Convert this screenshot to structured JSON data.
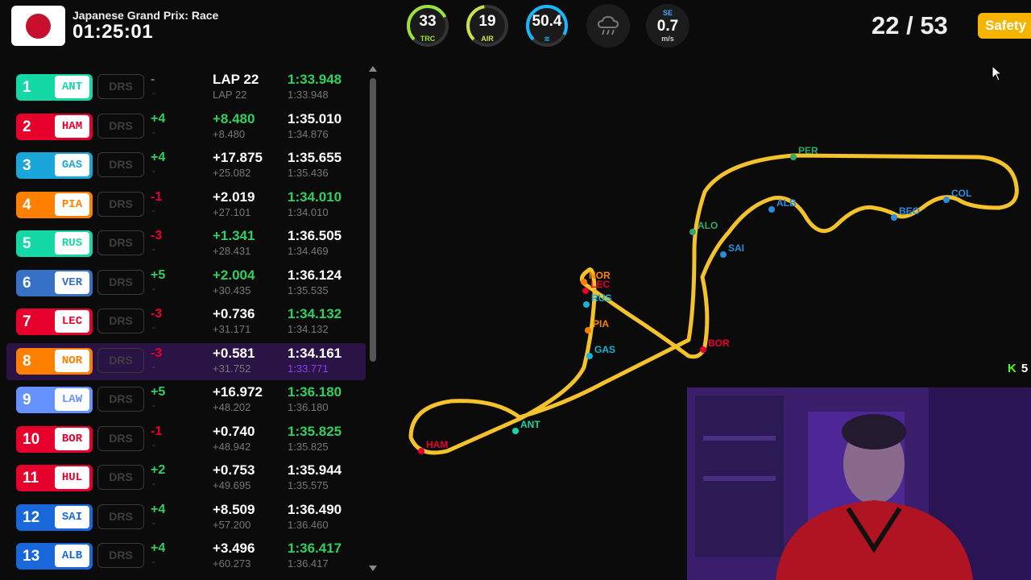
{
  "header": {
    "race_title": "Japanese Grand Prix: Race",
    "race_time": "01:25:01",
    "lap_label": "22 / 53",
    "safety_label": "Safety",
    "gauges": [
      {
        "value": "33",
        "label": "TRC",
        "color": "#9be13a",
        "fraction": 0.55
      },
      {
        "value": "19",
        "label": "AIR",
        "color": "#c7e34b",
        "fraction": 0.35
      },
      {
        "value": "50.4",
        "label": "",
        "color": "#19b7ff",
        "fraction": 0.7
      }
    ],
    "wind_direction": "SE",
    "wind_speed": "0.7",
    "wind_unit": "m/s",
    "weather_icon": "rain-cloud-icon"
  },
  "standings": [
    {
      "pos": "1",
      "code": "ANT",
      "color": "#14d9a6",
      "drs": "DRS",
      "change": "-",
      "change_color": "#777",
      "gap": "LAP 22",
      "sub_gap": "LAP 22",
      "lap": "1:33.948",
      "lap_color": "#2fd060",
      "sub_lap": "1:33.948"
    },
    {
      "pos": "2",
      "code": "HAM",
      "color": "#e8002d",
      "drs": "DRS",
      "change": "+4",
      "change_color": "#2fd060",
      "gap": "+8.480",
      "gap_color": "#2fd060",
      "sub_gap": "+8.480",
      "lap": "1:35.010",
      "lap_color": "#fff",
      "sub_lap": "1:34.876"
    },
    {
      "pos": "3",
      "code": "GAS",
      "color": "#1aa6d9",
      "drs": "DRS",
      "change": "+4",
      "change_color": "#2fd060",
      "gap": "+17.875",
      "gap_color": "#fff",
      "sub_gap": "+25.082",
      "lap": "1:35.655",
      "lap_color": "#fff",
      "sub_lap": "1:35.436"
    },
    {
      "pos": "4",
      "code": "PIA",
      "color": "#ff8000",
      "drs": "DRS",
      "change": "-1",
      "change_color": "#e8002d",
      "gap": "+2.019",
      "gap_color": "#fff",
      "sub_gap": "+27.101",
      "lap": "1:34.010",
      "lap_color": "#2fd060",
      "sub_lap": "1:34.010"
    },
    {
      "pos": "5",
      "code": "RUS",
      "color": "#14d9a6",
      "drs": "DRS",
      "change": "-3",
      "change_color": "#e8002d",
      "gap": "+1.341",
      "gap_color": "#2fd060",
      "sub_gap": "+28.431",
      "lap": "1:36.505",
      "lap_color": "#fff",
      "sub_lap": "1:34.469"
    },
    {
      "pos": "6",
      "code": "VER",
      "color": "#3671c6",
      "drs": "DRS",
      "change": "+5",
      "change_color": "#2fd060",
      "gap": "+2.004",
      "gap_color": "#2fd060",
      "sub_gap": "+30.435",
      "lap": "1:36.124",
      "lap_color": "#fff",
      "sub_lap": "1:35.535"
    },
    {
      "pos": "7",
      "code": "LEC",
      "color": "#e8002d",
      "drs": "DRS",
      "change": "-3",
      "change_color": "#e8002d",
      "gap": "+0.736",
      "gap_color": "#fff",
      "sub_gap": "+31.171",
      "lap": "1:34.132",
      "lap_color": "#2fd060",
      "sub_lap": "1:34.132"
    },
    {
      "pos": "8",
      "code": "NOR",
      "color": "#ff8000",
      "drs": "DRS",
      "change": "-3",
      "change_color": "#e8002d",
      "gap": "+0.581",
      "gap_color": "#fff",
      "sub_gap": "+31.752",
      "lap": "1:34.161",
      "lap_color": "#fff",
      "sub_lap": "1:33.771",
      "sub_lap_color": "#8a3ffc",
      "highlight": true
    },
    {
      "pos": "9",
      "code": "LAW",
      "color": "#6692ff",
      "drs": "DRS",
      "change": "+5",
      "change_color": "#2fd060",
      "gap": "+16.972",
      "gap_color": "#fff",
      "sub_gap": "+48.202",
      "lap": "1:36.180",
      "lap_color": "#2fd060",
      "sub_lap": "1:36.180"
    },
    {
      "pos": "10",
      "code": "BOR",
      "color": "#e8002d",
      "drs": "DRS",
      "change": "-1",
      "change_color": "#e8002d",
      "gap": "+0.740",
      "gap_color": "#fff",
      "sub_gap": "+48.942",
      "lap": "1:35.825",
      "lap_color": "#2fd060",
      "sub_lap": "1:35.825"
    },
    {
      "pos": "11",
      "code": "HUL",
      "color": "#e8002d",
      "drs": "DRS",
      "change": "+2",
      "change_color": "#2fd060",
      "gap": "+0.753",
      "gap_color": "#fff",
      "sub_gap": "+49.695",
      "lap": "1:35.944",
      "lap_color": "#fff",
      "sub_lap": "1:35.575"
    },
    {
      "pos": "12",
      "code": "SAI",
      "color": "#1868db",
      "drs": "DRS",
      "change": "+4",
      "change_color": "#2fd060",
      "gap": "+8.509",
      "gap_color": "#fff",
      "sub_gap": "+57.200",
      "lap": "1:36.490",
      "lap_color": "#fff",
      "sub_lap": "1:36.460"
    },
    {
      "pos": "13",
      "code": "ALB",
      "color": "#1868db",
      "drs": "DRS",
      "change": "+4",
      "change_color": "#2fd060",
      "gap": "+3.496",
      "gap_color": "#fff",
      "sub_gap": "+60.273",
      "lap": "1:36.417",
      "lap_color": "#2fd060",
      "sub_lap": "1:36.417"
    }
  ],
  "map_labels": [
    {
      "code": "PER",
      "color": "#2fa86a"
    },
    {
      "code": "ALB",
      "color": "#2b8de0"
    },
    {
      "code": "BEO",
      "color": "#2b8de0"
    },
    {
      "code": "COL",
      "color": "#2b8de0"
    },
    {
      "code": "ALO",
      "color": "#2fa86a"
    },
    {
      "code": "SAI",
      "color": "#2b8de0"
    },
    {
      "code": "NOR",
      "color": "#ff8000"
    },
    {
      "code": "LEC",
      "color": "#e8002d"
    },
    {
      "code": "RUS",
      "color": "#14b5d9"
    },
    {
      "code": "PIA",
      "color": "#ff8000"
    },
    {
      "code": "GAS",
      "color": "#14b5d9"
    },
    {
      "code": "BOR",
      "color": "#e8002d"
    },
    {
      "code": "ANT",
      "color": "#14d9a6"
    },
    {
      "code": "HAM",
      "color": "#e8002d"
    }
  ],
  "stream": {
    "viewers": "5",
    "platform_icon": "kick-icon"
  }
}
